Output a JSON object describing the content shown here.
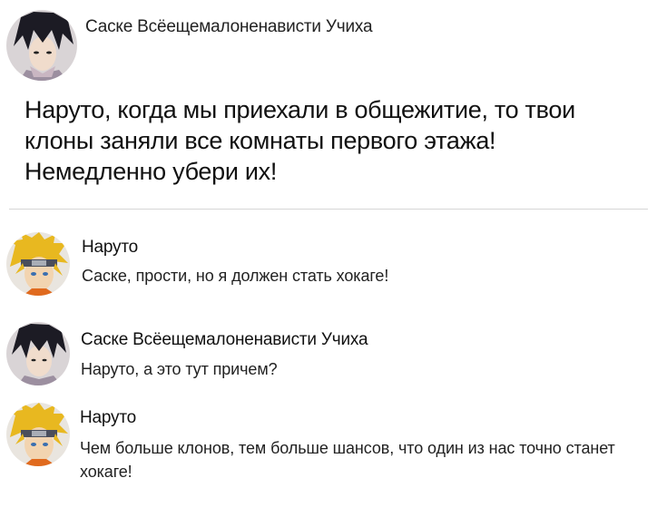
{
  "post": {
    "author": "Саске Всёещемалоненависти Учиха",
    "avatar_icon": "sasuke-avatar-icon",
    "text": "Наруто, когда мы приехали в общежитие, то твои клоны заняли все комнаты первого этажа! Немедленно убери их!"
  },
  "comments": [
    {
      "author": "Наруто",
      "avatar_icon": "naruto-avatar-icon",
      "text": "Саске, прости, но я должен стать хокаге!"
    },
    {
      "author": "Саске Всёещемалоненависти Учиха",
      "avatar_icon": "sasuke-avatar-icon",
      "text": "Наруто, а это тут причем?"
    },
    {
      "author": "Наруто",
      "avatar_icon": "naruto-avatar-icon",
      "text": "Чем больше клонов, тем больше шансов, что один из нас точно станет хокаге!"
    }
  ],
  "colors": {
    "divider": "#d6d6d6",
    "sasuke_hair": "#1c1b24",
    "naruto_hair": "#e8b820"
  }
}
